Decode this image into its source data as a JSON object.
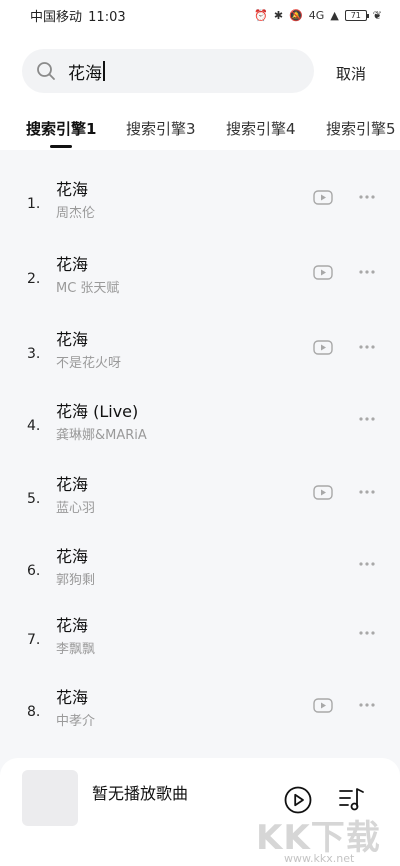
{
  "status_bar": {
    "carrier": "中国移动",
    "time": "11:03",
    "network": "4G",
    "battery": "71"
  },
  "search": {
    "query": "花海",
    "cancel_label": "取消"
  },
  "tabs": [
    {
      "label": "搜索引擎1",
      "active": true
    },
    {
      "label": "搜索引擎3",
      "active": false
    },
    {
      "label": "搜索引擎4",
      "active": false
    },
    {
      "label": "搜索引擎5",
      "active": false
    }
  ],
  "results": [
    {
      "index": "1.",
      "title": "花海",
      "artist": "周杰伦",
      "has_mv": true
    },
    {
      "index": "2.",
      "title": "花海",
      "artist": "MC 张天赋",
      "has_mv": true
    },
    {
      "index": "3.",
      "title": "花海",
      "artist": "不是花火呀",
      "has_mv": true
    },
    {
      "index": "4.",
      "title": "花海 (Live)",
      "artist": "龚琳娜&MARiA",
      "has_mv": false
    },
    {
      "index": "5.",
      "title": "花海",
      "artist": "蓝心羽",
      "has_mv": true
    },
    {
      "index": "6.",
      "title": "花海",
      "artist": "郭狗剩",
      "has_mv": false
    },
    {
      "index": "7.",
      "title": "花海",
      "artist": "李飘飘",
      "has_mv": false
    },
    {
      "index": "8.",
      "title": "花海",
      "artist": "中孝介",
      "has_mv": true
    }
  ],
  "player": {
    "now_playing": "暂无播放歌曲"
  },
  "watermark": {
    "brand": "KK下载",
    "url": "www.kkx.net"
  }
}
